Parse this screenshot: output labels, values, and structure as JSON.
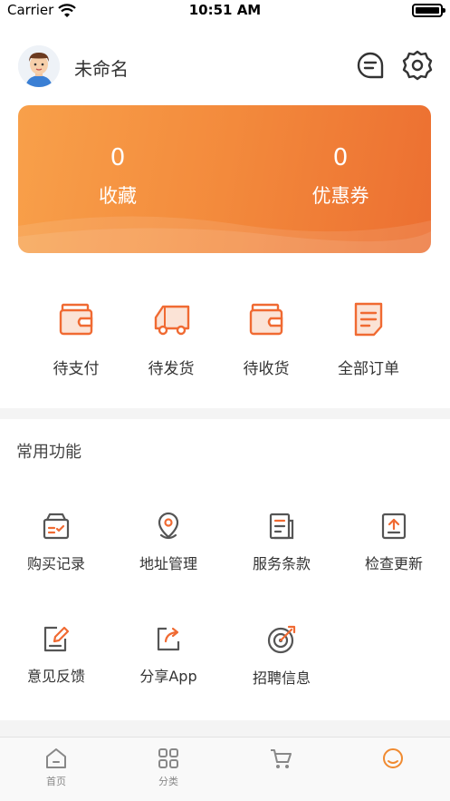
{
  "status_bar": {
    "carrier": "Carrier",
    "time": "10:51 AM"
  },
  "profile": {
    "name": "未命名"
  },
  "stats": [
    {
      "value": "0",
      "label": "收藏"
    },
    {
      "value": "0",
      "label": "优惠券"
    }
  ],
  "orders": [
    {
      "label": "待支付",
      "icon": "wallet-icon"
    },
    {
      "label": "待发货",
      "icon": "truck-icon"
    },
    {
      "label": "待收货",
      "icon": "wallet-icon"
    },
    {
      "label": "全部订单",
      "icon": "document-icon"
    }
  ],
  "common_functions": {
    "title": "常用功能",
    "items": [
      {
        "label": "购买记录",
        "icon": "purchase-record-icon"
      },
      {
        "label": "地址管理",
        "icon": "location-pin-icon"
      },
      {
        "label": "服务条款",
        "icon": "terms-icon"
      },
      {
        "label": "检查更新",
        "icon": "update-icon"
      },
      {
        "label": "意见反馈",
        "icon": "feedback-icon"
      },
      {
        "label": "分享App",
        "icon": "share-icon"
      },
      {
        "label": "招聘信息",
        "icon": "target-icon"
      }
    ]
  },
  "tabbar": {
    "items": [
      {
        "label": "首页",
        "icon": "home-icon"
      },
      {
        "label": "分类",
        "icon": "category-icon"
      }
    ]
  },
  "colors": {
    "accent": "#f08a30",
    "card_start": "#f8a04a",
    "card_end": "#ec6f31",
    "icon_orange": "#f06a32",
    "icon_gray": "#555555"
  }
}
